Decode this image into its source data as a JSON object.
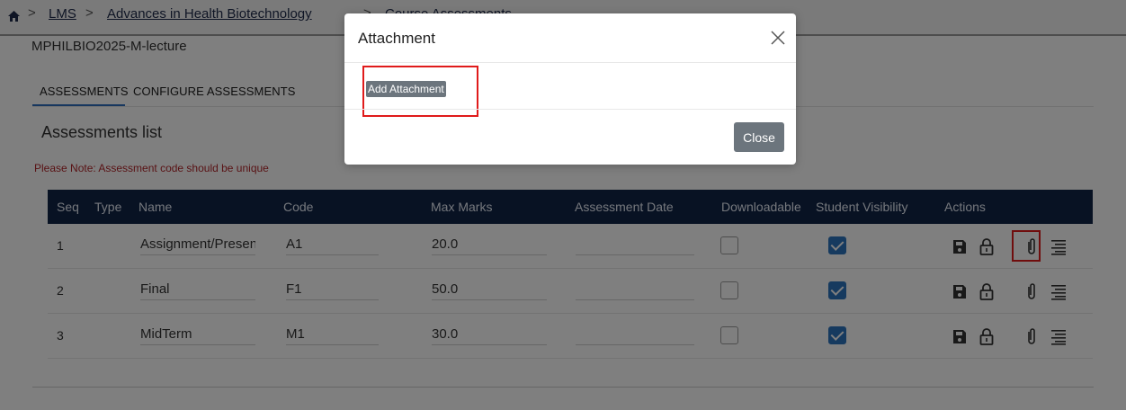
{
  "breadcrumb": {
    "sep": ">",
    "items": [
      "LMS",
      "Advances in Health Biotechnology",
      "Course Assessments"
    ]
  },
  "course_code": "MPHILBIO2025-M-lecture",
  "tabs": [
    {
      "label": "ASSESSMENTS",
      "active": true
    },
    {
      "label": "CONFIGURE ASSESSMENTS",
      "active": false
    }
  ],
  "section_title": "Assessments list",
  "note": "Please Note: Assessment code should be unique",
  "table": {
    "headers": [
      "Seq",
      "Type",
      "Name",
      "Code",
      "Max Marks",
      "Assessment Date",
      "Downloadable",
      "Student Visibility",
      "Actions"
    ],
    "rows": [
      {
        "seq": "1",
        "name": "Assignment/Presentation",
        "code": "A1",
        "max_marks": "20.0",
        "date": "",
        "downloadable": false,
        "visible": true
      },
      {
        "seq": "2",
        "name": "Final",
        "code": "F1",
        "max_marks": "50.0",
        "date": "",
        "downloadable": false,
        "visible": true
      },
      {
        "seq": "3",
        "name": "MidTerm",
        "code": "M1",
        "max_marks": "30.0",
        "date": "",
        "downloadable": false,
        "visible": true
      }
    ]
  },
  "action_icons": [
    "save-icon",
    "lock-icon",
    "paperclip-icon",
    "list-icon"
  ],
  "modal": {
    "title": "Attachment",
    "add_attachment_label": "Add Attachment",
    "close_label": "Close"
  },
  "colors": {
    "header_bg": "#102447",
    "accent": "#2c75bf",
    "highlight": "#e01b1b",
    "button": "#6c757d"
  }
}
